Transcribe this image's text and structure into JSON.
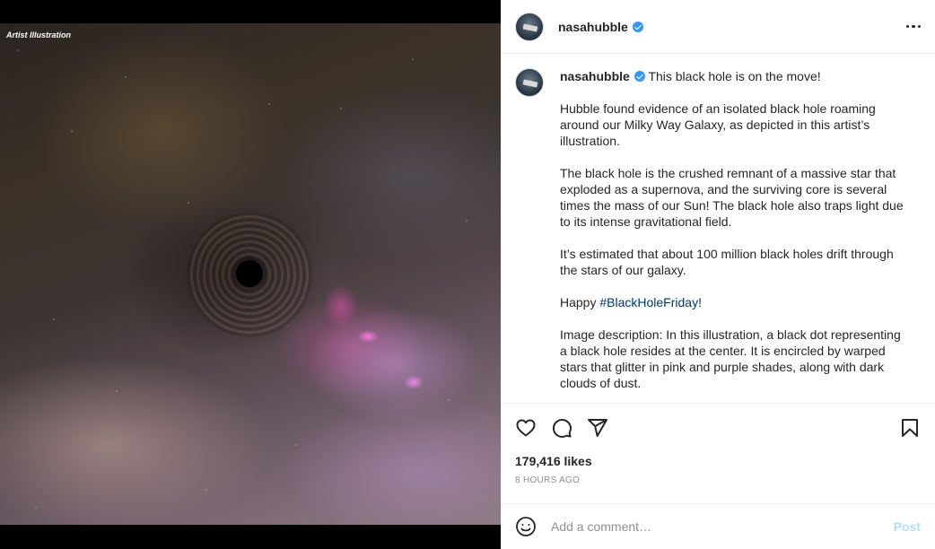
{
  "media": {
    "caption_overlay": "Artist Illustration"
  },
  "header": {
    "username": "nasahubble"
  },
  "post": {
    "username": "nasahubble",
    "headline": "This black hole is on the move!",
    "paragraphs": {
      "p1": "Hubble found evidence of an isolated black hole roaming around our Milky Way Galaxy, as depicted in this artist’s illustration.",
      "p2": "The black hole is the crushed remnant of a massive star that exploded as a supernova, and the surviving core is several times the mass of our Sun! The black hole also traps light due to its intense gravitational field.",
      "p3": "It’s estimated that about 100 million black holes drift through the stars of our galaxy.",
      "p4_prefix": "Happy ",
      "p4_hashtag": "#BlackHoleFriday",
      "p4_suffix": "!",
      "p5": "Image description: In this illustration, a black dot representing a black hole resides at the center. It is encircled by warped stars that glitter in pink and purple shades, along with dark clouds of dust."
    }
  },
  "engagement": {
    "likes": "179,416 likes",
    "timestamp": "8 HOURS AGO"
  },
  "comment_box": {
    "placeholder": "Add a comment…",
    "post_label": "Post"
  },
  "colors": {
    "verified": "#3897f0",
    "hashtag": "#00376b",
    "post_disabled": "#b2dffc"
  },
  "icons": [
    "more-options-icon",
    "verified-badge-icon",
    "heart-icon",
    "comment-icon",
    "share-icon",
    "bookmark-icon",
    "emoji-icon"
  ]
}
